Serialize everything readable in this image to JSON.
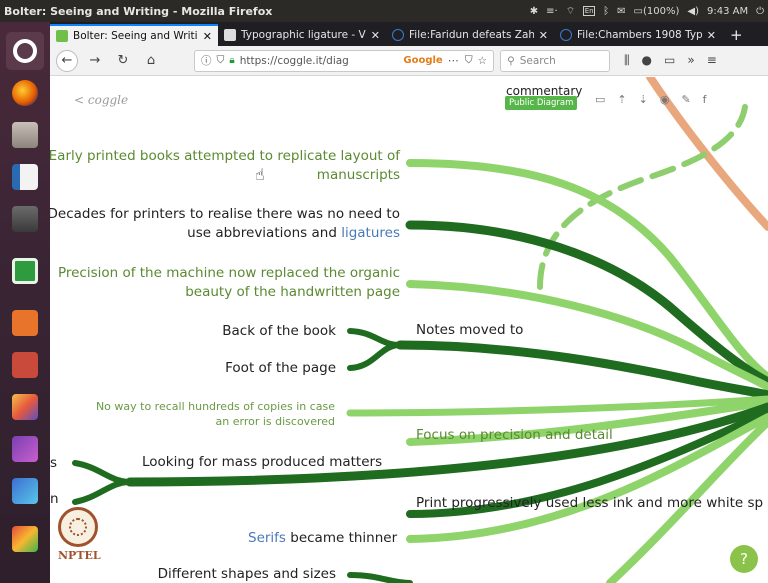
{
  "window": {
    "title": "Bolter: Seeing and Writing - Mozilla Firefox",
    "tray": {
      "keyboard": "En",
      "battery": "(100%)",
      "volume": "\u0005",
      "time": "9:43 AM"
    }
  },
  "launcher": {
    "items": [
      "dash",
      "firefox",
      "files",
      "writer",
      "impress",
      "calc",
      "software-center",
      "settings",
      "app-1",
      "app-2",
      "app-3"
    ]
  },
  "tabs": [
    {
      "label": "Bolter: Seeing and Writi",
      "active": true
    },
    {
      "label": "Typographic ligature - V",
      "active": false
    },
    {
      "label": "File:Faridun defeats Zah",
      "active": false
    },
    {
      "label": "File:Chambers 1908 Typ",
      "active": false
    }
  ],
  "navbar": {
    "url": "https://coggle.it/diag",
    "search_engine_badge": "Google",
    "page_actions": "⋯",
    "search_placeholder": "Search"
  },
  "coggle": {
    "back_link": "< coggle",
    "public_badge": "Public Diagram",
    "top_text": "commentary"
  },
  "nodes": {
    "early_printed": [
      "Early printed books attempted to replicate layout of",
      "manuscripts"
    ],
    "decades_line1": "Decades for printers to realise there was no need to",
    "decades_line2_pre": "use abbreviations and ",
    "decades_link": "ligatures",
    "precision_machine": [
      "Precision of the machine now replaced the organic",
      "beauty of the handwritten page"
    ],
    "back_of_book": "Back of the book",
    "foot_of_page": "Foot of the page",
    "notes_moved": "Notes moved to",
    "no_way": [
      "No way to recall hundreds of copies in case",
      "an error is discovered"
    ],
    "focus_precision": "Focus on precision and detail",
    "mass_produced": "Looking for mass produced matters",
    "print_progressively": "Print progressively used less ink and more white sp",
    "serifs_link": "Serifs",
    "serifs_rest": " became thinner",
    "different_shapes": "Different shapes and sizes",
    "left_edge_1": "s",
    "left_edge_2": "n"
  },
  "nptel": {
    "brand": "NPTEL"
  },
  "help": "?",
  "colors": {
    "dark_green": "#1f6b1f",
    "mid_green": "#5fae3c",
    "light_green": "#9bd67a",
    "link_blue": "#4a79b8",
    "orange": "#e8a77c"
  }
}
